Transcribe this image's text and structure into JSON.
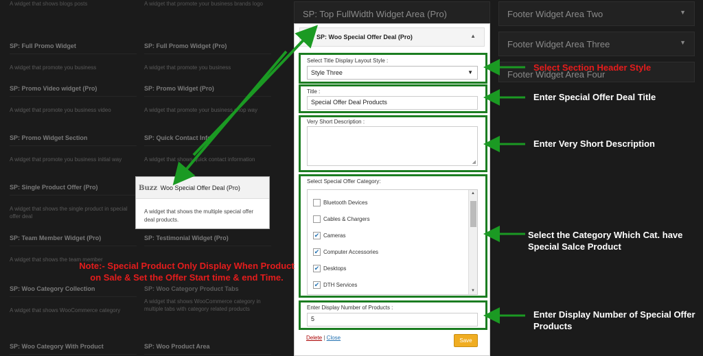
{
  "background_widgets": [
    {
      "title": "SP: Full Promo Widget",
      "desc": "A widget that promote you business"
    },
    {
      "title": "SP: Full Promo Widget (Pro)",
      "desc": "A widget that promote you business"
    },
    {
      "title": "SP: Promo Video widget (Pro)",
      "desc": "A widget that promote you business video"
    },
    {
      "title": "SP: Promo Widget (Pro)",
      "desc": "A widget that promote your business shop way"
    },
    {
      "title": "SP: Promo Widget Section",
      "desc": "A widget that promote you business initial way"
    },
    {
      "title": "SP: Quick Contact Info",
      "desc": "A widget that shows quick contact information"
    },
    {
      "title": "SP: Single Product Offer (Pro)",
      "desc": "A widget that shows the single product in special offer deal"
    },
    {
      "title": "SP: Team Member Widget (Pro)",
      "desc": "A widget that shows the team member"
    },
    {
      "title": "SP: Testimonial Widget (Pro)",
      "desc": ""
    },
    {
      "title": "SP: Woo Category Collection",
      "desc": "A widget that shows WooCommerce category"
    },
    {
      "title": "SP: Woo Category Product Tabs",
      "desc": "A widget that shows WooCommerce category in multiple tabs with category related products"
    },
    {
      "title": "SP: Woo Category With Product",
      "desc": ""
    },
    {
      "title": "SP: Woo Product Area",
      "desc": ""
    }
  ],
  "widget_areas": {
    "top_fullwidth": "SP: Top FullWidth Widget Area (Pro)",
    "footer_two": "Footer Widget Area Two",
    "footer_three": "Footer Widget Area Three",
    "footer_four": "Footer Widget Area Four"
  },
  "panel": {
    "title": "SP: Woo Special Offer Deal (Pro)",
    "layout_label": "Select Title Display Layout Style :",
    "layout_value": "Style Three",
    "title_label": "Title :",
    "title_value": "Special Offer Deal Products",
    "desc_label": "Very Short Description :",
    "desc_value": "",
    "category_label": "Select Special Offer Category:",
    "categories": [
      {
        "label": "Bluetooth Devices",
        "checked": false
      },
      {
        "label": "Cables & Chargers",
        "checked": false
      },
      {
        "label": "Cameras",
        "checked": true
      },
      {
        "label": "Computer Accessories",
        "checked": true
      },
      {
        "label": "Desktops",
        "checked": true
      },
      {
        "label": "DTH Services",
        "checked": true
      }
    ],
    "number_label": "Enter Display Number of Products :",
    "number_value": "5",
    "delete_label": "Delete",
    "separator": "|",
    "close_label": "Close",
    "save_label": "Save"
  },
  "popup": {
    "logo": "Buzz",
    "title": "Woo Special Offer Deal (Pro)",
    "desc": "A widget that shows the multiple special offer deal products."
  },
  "annotations": {
    "header_style": "Select Section Header Style",
    "title": "Enter Special Offer Deal Title",
    "description": "Enter Very Short Description",
    "category": "Select the Category Which Cat. have Special Salce Product",
    "number": "Enter Display Number of Special Offer Products",
    "note": "Note:- Special Product Only Display When Product on Sale & Set the Offer Start time & end Time."
  },
  "colors": {
    "highlight": "#1b7d21",
    "note": "#e51c1c",
    "save": "#f0ad22"
  }
}
